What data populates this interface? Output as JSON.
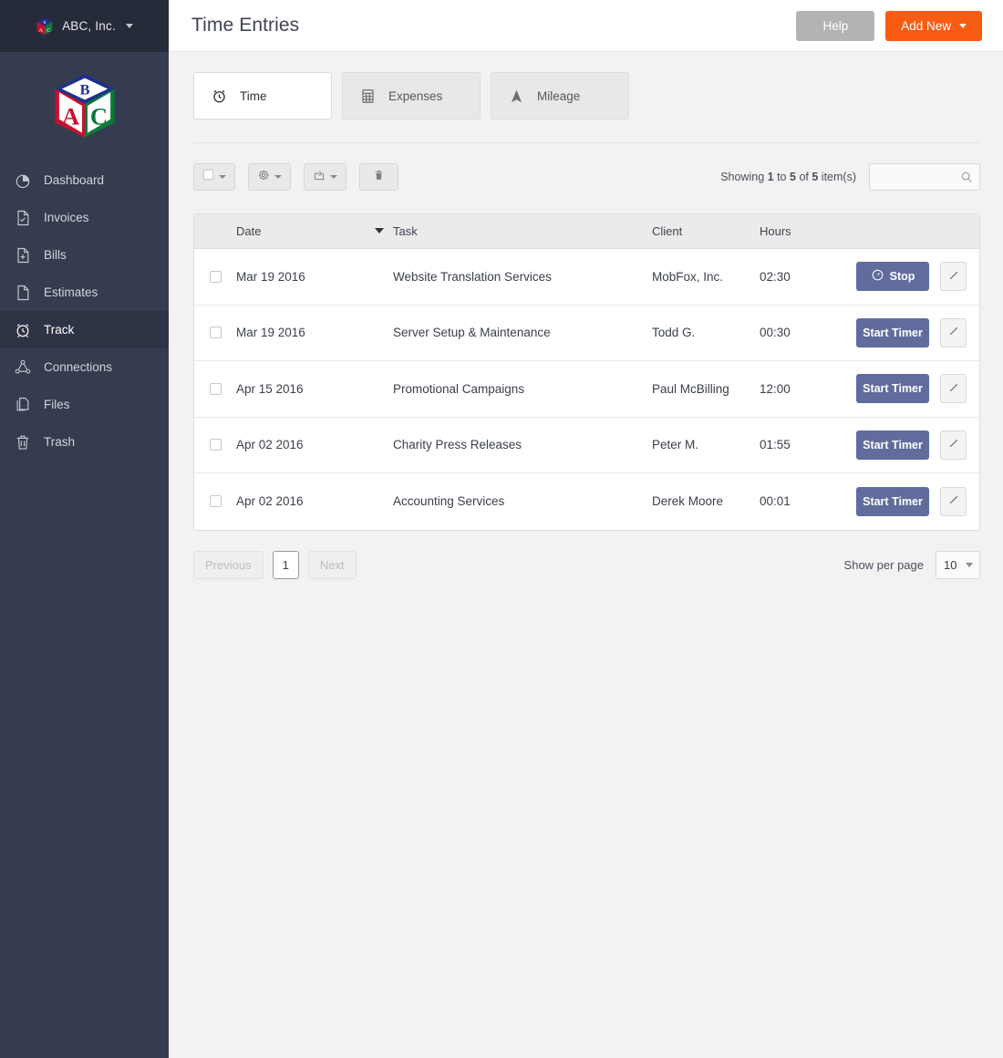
{
  "brand": {
    "name": "ABC, Inc.",
    "logo_icon": "abc-block-cube-icon",
    "caret_icon": "chevron-down-icon"
  },
  "sidebar": {
    "logo_icon": "abc-block-cube-logo",
    "items": [
      {
        "label": "Dashboard",
        "icon": "pie-chart-icon",
        "active": false
      },
      {
        "label": "Invoices",
        "icon": "document-check-icon",
        "active": false
      },
      {
        "label": "Bills",
        "icon": "document-plus-icon",
        "active": false
      },
      {
        "label": "Estimates",
        "icon": "document-icon",
        "active": false
      },
      {
        "label": "Track",
        "icon": "alarm-clock-icon",
        "active": true
      },
      {
        "label": "Connections",
        "icon": "network-nodes-icon",
        "active": false
      },
      {
        "label": "Files",
        "icon": "files-copy-icon",
        "active": false
      },
      {
        "label": "Trash",
        "icon": "trash-can-icon",
        "active": false
      }
    ]
  },
  "header": {
    "title": "Time Entries",
    "help_label": "Help",
    "add_new_label": "Add New",
    "help_color": "#b3b3b3",
    "add_new_color": "#f95b13"
  },
  "tabs": [
    {
      "label": "Time",
      "icon": "alarm-clock-icon",
      "active": true
    },
    {
      "label": "Expenses",
      "icon": "calculator-icon",
      "active": false
    },
    {
      "label": "Mileage",
      "icon": "arrow-up-icon",
      "active": false
    }
  ],
  "toolbar": {
    "select_all_icon": "checkbox-icon",
    "settings_icon": "gear-icon",
    "export_icon": "share-arrow-icon",
    "delete_icon": "trash-can-icon",
    "showing_prefix": "Showing",
    "showing_from": "1",
    "showing_mid": "to",
    "showing_to": "5",
    "showing_of": "of",
    "showing_total": "5",
    "showing_suffix": "item(s)",
    "search_value": "",
    "search_placeholder": "",
    "search_icon": "search-icon"
  },
  "table": {
    "columns": [
      "Date",
      "Task",
      "Client",
      "Hours"
    ],
    "sort_column": "Date",
    "sort_direction": "desc",
    "edit_icon": "pencil-icon",
    "stop_icon": "stopwatch-icon",
    "rows": [
      {
        "date": "Mar 19 2016",
        "task": "Website Translation Services",
        "client": "MobFox, Inc.",
        "hours": "02:30",
        "action": "Stop",
        "running": true
      },
      {
        "date": "Mar 19 2016",
        "task": "Server Setup & Maintenance",
        "client": "Todd G.",
        "hours": "00:30",
        "action": "Start Timer",
        "running": false
      },
      {
        "date": "Apr 15 2016",
        "task": "Promotional Campaigns",
        "client": "Paul McBilling",
        "hours": "12:00",
        "action": "Start Timer",
        "running": false
      },
      {
        "date": "Apr 02 2016",
        "task": "Charity Press Releases",
        "client": "Peter M.",
        "hours": "01:55",
        "action": "Start Timer",
        "running": false
      },
      {
        "date": "Apr 02 2016",
        "task": "Accounting Services",
        "client": "Derek Moore",
        "hours": "00:01",
        "action": "Start Timer",
        "running": false
      }
    ]
  },
  "pagination": {
    "previous_label": "Previous",
    "page_label": "1",
    "next_label": "Next",
    "show_per_page_label": "Show per page",
    "per_page_value": "10"
  }
}
